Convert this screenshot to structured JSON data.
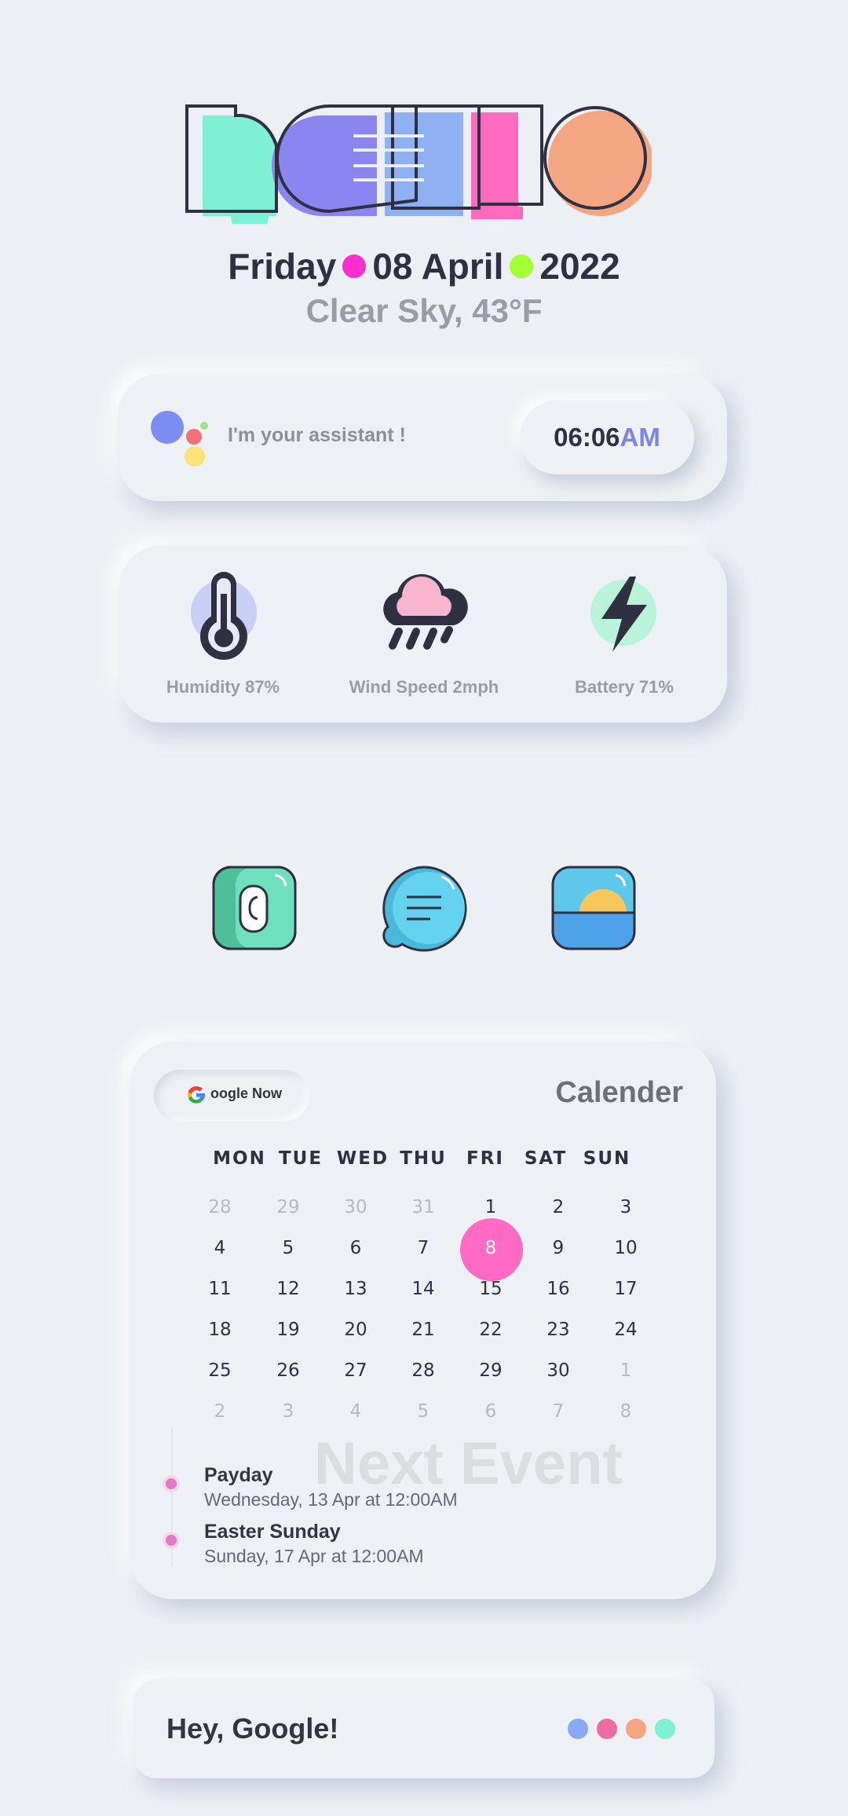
{
  "hello_logo": {
    "text": "HELLO",
    "colors": [
      "#7ef0d3",
      "#8b86ef",
      "#8fb0f2",
      "#ff6bbf",
      "#f4a582"
    ]
  },
  "date": {
    "weekday": "Friday",
    "day_month": "08 April",
    "year": "2022",
    "dot_colors": [
      "#ff2fcf",
      "#a4ff34"
    ]
  },
  "weather": "Clear Sky, 43°F",
  "assistant": {
    "text": "I'm your assistant !",
    "time": "06:06",
    "ampm": "AM"
  },
  "stats": [
    {
      "icon": "thermometer-icon",
      "label": "Humidity 87%"
    },
    {
      "icon": "rain-cloud-icon",
      "label": "Wind Speed 2mph"
    },
    {
      "icon": "lightning-icon",
      "label": "Battery 71%"
    }
  ],
  "apps": [
    {
      "icon": "phone-app-icon"
    },
    {
      "icon": "messages-app-icon"
    },
    {
      "icon": "gallery-app-icon"
    }
  ],
  "calendar": {
    "gnow_label": "oogle Now",
    "title": "Calender",
    "weekdays": [
      "MON",
      "TUE",
      "WED",
      "THU",
      "FRI",
      "SAT",
      "SUN"
    ],
    "rows": [
      [
        "28",
        "29",
        "30",
        "31",
        "1",
        "2",
        "3"
      ],
      [
        "4",
        "5",
        "6",
        "7",
        "8",
        "9",
        "10"
      ],
      [
        "11",
        "12",
        "13",
        "14",
        "15",
        "16",
        "17"
      ],
      [
        "18",
        "19",
        "20",
        "21",
        "22",
        "23",
        "24"
      ],
      [
        "25",
        "26",
        "27",
        "28",
        "29",
        "30",
        "1"
      ],
      [
        "2",
        "3",
        "4",
        "5",
        "6",
        "7",
        "8"
      ]
    ],
    "today": "8",
    "today_color": "#ff6bc4"
  },
  "events": {
    "heading": "Next Event",
    "items": [
      {
        "title": "Payday",
        "when": "Wednesday, 13 Apr at 12:00AM"
      },
      {
        "title": "Easter Sunday",
        "when": "Sunday, 17 Apr at 12:00AM"
      }
    ]
  },
  "google_bar": {
    "text": "Hey, Google!",
    "dot_colors": [
      "#8aa8f5",
      "#f06aa5",
      "#f4a582",
      "#7ef0d3"
    ]
  }
}
